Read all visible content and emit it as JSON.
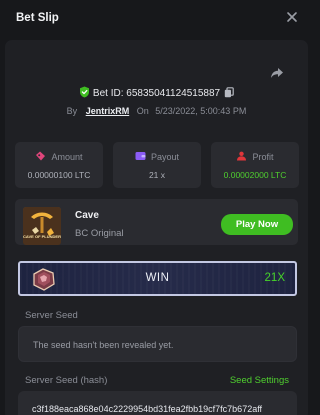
{
  "header": {
    "title": "Bet Slip"
  },
  "bet": {
    "id_text": "Bet ID: 65835041124515887",
    "by_label": "By",
    "user": "JentrixRM",
    "on_label": "On",
    "date": "5/23/2022, 5:00:43 PM"
  },
  "stats": [
    {
      "label": "Amount",
      "value": "0.00000100 LTC"
    },
    {
      "label": "Payout",
      "value": "21 x"
    },
    {
      "label": "Profit",
      "value": "0.00002000 LTC"
    }
  ],
  "game": {
    "name": "Cave",
    "provider": "BC Original",
    "play_label": "Play Now",
    "thumb_text": "CAVE OF PLUNDER"
  },
  "result": {
    "label": "WIN",
    "multiplier": "21X"
  },
  "server_seed": {
    "label": "Server Seed",
    "value": "The seed hasn't been revealed yet."
  },
  "server_seed_hash": {
    "label": "Server Seed (hash)",
    "settings_label": "Seed Settings",
    "value": "c3f188eaca868e04c2229954bd31fea2fbb19cf7fc7b672aff"
  },
  "colors": {
    "accent_green": "#3fbd22",
    "profit_green": "#4fcf2f",
    "amount_icon": "#e0457b",
    "payout_icon": "#8b5cf6",
    "profit_icon": "#e0363a"
  },
  "icons": {
    "close": "close-icon",
    "share": "share-icon",
    "verified": "shield-check-icon",
    "copy": "copy-icon",
    "amount": "ticket-icon",
    "payout": "wallet-icon",
    "profit": "people-icon",
    "result": "gem-icon"
  }
}
